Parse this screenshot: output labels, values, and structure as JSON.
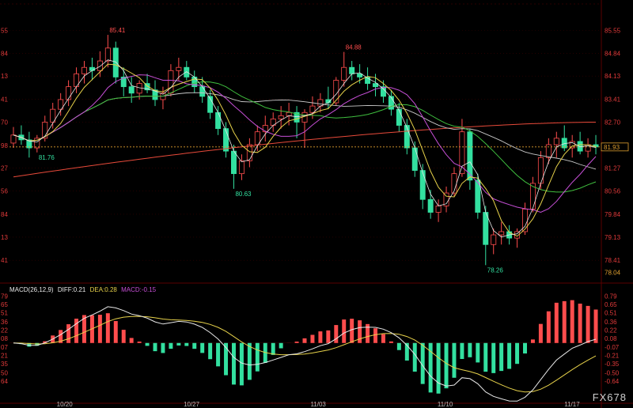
{
  "chart_data": [
    {
      "type": "candlestick",
      "panel": "price",
      "ylim": [
        77.9,
        86.05
      ],
      "y_ticks_right": [
        "85.55",
        "84.84",
        "84.13",
        "83.41",
        "82.70",
        "81.98",
        "81.27",
        "80.56",
        "79.84",
        "79.13",
        "78.41"
      ],
      "y_ticks_left": [
        "55",
        "84",
        "13",
        "41",
        "70",
        "98",
        "27",
        "56",
        "84",
        "13",
        "41"
      ],
      "current_price": "81.93",
      "bottom_label": "78.04",
      "annotations": {
        "high1": "85.41",
        "high2": "84.88",
        "low1": "81.76",
        "low2": "80.63",
        "low3": "78.26"
      },
      "ref_line": 81.93,
      "candles": [
        [
          82.05,
          82.55,
          81.9,
          82.3
        ],
        [
          82.3,
          82.6,
          82.0,
          82.15
        ],
        [
          82.15,
          82.4,
          81.6,
          81.9
        ],
        [
          81.9,
          82.3,
          81.76,
          82.2
        ],
        [
          82.2,
          82.9,
          82.1,
          82.7
        ],
        [
          82.7,
          83.3,
          82.5,
          83.1
        ],
        [
          83.1,
          83.6,
          82.9,
          83.4
        ],
        [
          83.4,
          84.0,
          83.2,
          83.8
        ],
        [
          83.8,
          84.4,
          83.6,
          84.2
        ],
        [
          84.2,
          84.6,
          83.9,
          84.4
        ],
        [
          84.4,
          84.7,
          84.0,
          84.3
        ],
        [
          84.3,
          84.9,
          84.1,
          84.6
        ],
        [
          84.6,
          85.41,
          84.4,
          85.0
        ],
        [
          85.0,
          85.2,
          83.9,
          84.1
        ],
        [
          84.1,
          84.4,
          83.5,
          83.8
        ],
        [
          83.8,
          84.1,
          83.3,
          83.6
        ],
        [
          83.6,
          84.0,
          83.4,
          83.9
        ],
        [
          83.9,
          84.2,
          83.6,
          83.7
        ],
        [
          83.7,
          84.0,
          83.2,
          83.4
        ],
        [
          83.4,
          83.8,
          83.1,
          83.6
        ],
        [
          83.6,
          84.5,
          83.5,
          84.3
        ],
        [
          84.3,
          84.7,
          84.0,
          84.4
        ],
        [
          84.4,
          84.6,
          84.0,
          84.1
        ],
        [
          84.1,
          84.3,
          83.6,
          83.8
        ],
        [
          83.8,
          84.1,
          83.3,
          83.5
        ],
        [
          83.5,
          83.7,
          82.8,
          83.0
        ],
        [
          83.0,
          83.2,
          82.3,
          82.5
        ],
        [
          82.5,
          82.7,
          81.6,
          81.8
        ],
        [
          81.8,
          82.0,
          80.63,
          81.1
        ],
        [
          81.1,
          81.7,
          80.9,
          81.5
        ],
        [
          81.5,
          82.2,
          81.3,
          82.0
        ],
        [
          82.0,
          82.6,
          81.8,
          82.4
        ],
        [
          82.4,
          82.9,
          82.1,
          82.6
        ],
        [
          82.6,
          83.0,
          82.4,
          82.8
        ],
        [
          82.8,
          83.2,
          82.5,
          82.9
        ],
        [
          82.9,
          83.3,
          82.6,
          83.0
        ],
        [
          83.0,
          83.2,
          82.2,
          82.7
        ],
        [
          82.7,
          83.1,
          81.9,
          83.0
        ],
        [
          83.0,
          83.5,
          82.8,
          83.2
        ],
        [
          83.2,
          83.6,
          83.0,
          83.4
        ],
        [
          83.4,
          83.8,
          83.1,
          83.3
        ],
        [
          83.3,
          84.1,
          83.2,
          84.0
        ],
        [
          84.0,
          84.88,
          83.8,
          84.4
        ],
        [
          84.4,
          84.6,
          84.0,
          84.2
        ],
        [
          84.2,
          84.5,
          83.9,
          84.1
        ],
        [
          84.1,
          84.4,
          83.7,
          83.9
        ],
        [
          83.9,
          84.2,
          83.5,
          83.8
        ],
        [
          83.8,
          84.0,
          83.3,
          83.5
        ],
        [
          83.5,
          83.7,
          82.9,
          83.1
        ],
        [
          83.1,
          83.3,
          82.4,
          82.6
        ],
        [
          82.6,
          82.8,
          81.7,
          81.9
        ],
        [
          81.9,
          82.1,
          81.0,
          81.2
        ],
        [
          81.2,
          81.4,
          80.0,
          80.3
        ],
        [
          80.3,
          80.6,
          79.7,
          79.9
        ],
        [
          79.9,
          80.3,
          79.6,
          80.1
        ],
        [
          80.1,
          80.7,
          79.9,
          80.5
        ],
        [
          80.5,
          81.3,
          80.4,
          81.1
        ],
        [
          81.1,
          82.8,
          81.0,
          82.4
        ],
        [
          82.4,
          82.5,
          80.6,
          80.9
        ],
        [
          80.9,
          81.1,
          79.7,
          79.9
        ],
        [
          79.9,
          80.1,
          78.26,
          78.9
        ],
        [
          78.9,
          79.4,
          78.6,
          79.2
        ],
        [
          79.2,
          79.6,
          78.9,
          79.3
        ],
        [
          79.3,
          79.5,
          78.9,
          79.1
        ],
        [
          79.1,
          79.4,
          78.8,
          79.3
        ],
        [
          79.3,
          80.2,
          79.2,
          80.0
        ],
        [
          80.0,
          81.0,
          79.9,
          80.8
        ],
        [
          80.8,
          81.8,
          80.6,
          81.6
        ],
        [
          81.6,
          82.2,
          81.4,
          82.0
        ],
        [
          82.0,
          82.4,
          81.6,
          82.2
        ],
        [
          82.2,
          82.6,
          81.8,
          81.9
        ],
        [
          81.9,
          82.3,
          81.6,
          82.1
        ],
        [
          82.1,
          82.4,
          81.7,
          81.8
        ],
        [
          81.8,
          82.2,
          81.6,
          82.0
        ],
        [
          82.0,
          82.3,
          81.7,
          81.93
        ]
      ]
    },
    {
      "type": "macd",
      "panel": "indicator",
      "legend": {
        "name": "MACD(26,12,9)",
        "diff_label": "DIFF:0.21",
        "dea_label": "DEA:0.28",
        "macd_label": "MACD:-0.15"
      },
      "ylim": [
        -0.95,
        0.85
      ],
      "y_ticks_right": [
        "0.79",
        "0.65",
        "0.51",
        "0.36",
        "0.22",
        "0.08",
        "-0.07",
        "-0.21",
        "-0.35",
        "-0.50",
        "-0.64"
      ],
      "y_ticks_left": [
        "79",
        "65",
        "51",
        "36",
        "22",
        "08",
        "07",
        "21",
        "35",
        "50",
        "64"
      ],
      "x_labels": [
        "10/20",
        "10/27",
        "11/03",
        "11/10",
        "11/17"
      ]
    }
  ],
  "footer": {
    "watermark": "FX678"
  },
  "colors": {
    "up": "#ff4d4d",
    "down": "#33e0a0",
    "ma1": "#e8e8e8",
    "ma2": "#e6d14a",
    "ma3": "#c64fd6",
    "ma4": "#3fbf3f",
    "ma5": "#c8c8c8",
    "ma6": "#e84a3a",
    "dea": "#e6d14a",
    "diff": "#e8e8e8",
    "axis_text": "#e03a3a",
    "grid": "#3a0000"
  }
}
